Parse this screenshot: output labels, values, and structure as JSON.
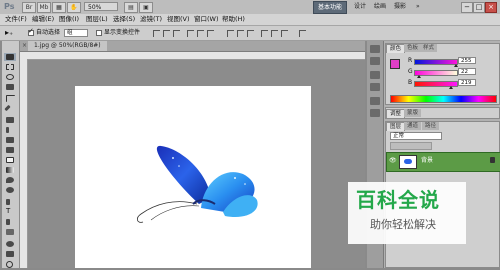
{
  "app": {
    "logo": "Ps",
    "zoom": "50%",
    "workspaces": [
      "基本功能",
      "设计",
      "绘画",
      "摄影"
    ],
    "active_workspace": "基本功能"
  },
  "menu": [
    "文件(F)",
    "编辑(E)",
    "图像(I)",
    "图层(L)",
    "选择(S)",
    "滤镜(T)",
    "视图(V)",
    "窗口(W)",
    "帮助(H)"
  ],
  "options": {
    "auto_select_label": "自动选择",
    "auto_select_checked": true,
    "auto_select_target": "组",
    "show_transform_label": "显示变换控件",
    "show_transform_checked": false
  },
  "document": {
    "tab_title": "1.jpg @ 50%(RGB/8#)",
    "close_glyph": "×"
  },
  "color_panel": {
    "tabs": [
      "颜色",
      "色板",
      "样式"
    ],
    "channels": [
      {
        "label": "R",
        "value": "255",
        "color": "#ff0000"
      },
      {
        "label": "G",
        "value": "22",
        "color": "#00b000"
      },
      {
        "label": "B",
        "value": "219",
        "color": "#0000ff"
      }
    ],
    "foreground": "#e13fc7"
  },
  "adjust_panel": {
    "tabs": [
      "调整",
      "蒙版"
    ]
  },
  "layers_panel": {
    "tabs": [
      "图层",
      "通道",
      "路径"
    ],
    "blend_mode": "正常",
    "layer_name": "背景"
  },
  "watermark": {
    "title": "百科全说",
    "subtitle": "助你轻松解决"
  }
}
